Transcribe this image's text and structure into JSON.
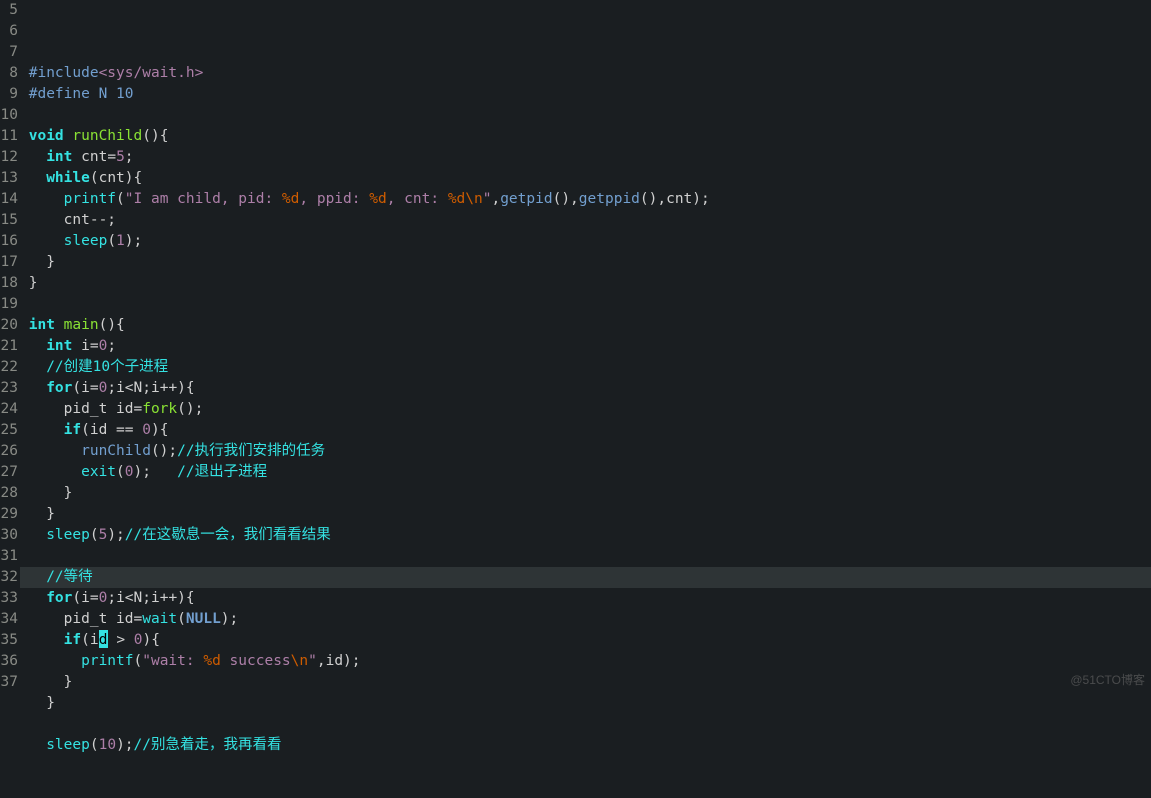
{
  "watermark": "@51CTO博客",
  "line_start": 5,
  "highlight_line": 32,
  "lines": [
    [
      {
        "c": "tk-pl",
        "t": " "
      },
      {
        "c": "tk-pp",
        "t": "#include"
      },
      {
        "c": "tk-inc",
        "t": "<sys/wait.h>"
      }
    ],
    [
      {
        "c": "tk-pl",
        "t": " "
      },
      {
        "c": "tk-pp",
        "t": "#define N 10"
      }
    ],
    [
      {
        "c": "tk-pl",
        "t": ""
      }
    ],
    [
      {
        "c": "tk-pl",
        "t": " "
      },
      {
        "c": "tk-kw",
        "t": "void"
      },
      {
        "c": "tk-pl",
        "t": " "
      },
      {
        "c": "tk-ty",
        "t": "runChild"
      },
      {
        "c": "tk-pl",
        "t": "(){"
      }
    ],
    [
      {
        "c": "tk-pl",
        "t": "   "
      },
      {
        "c": "tk-kw",
        "t": "int"
      },
      {
        "c": "tk-pl",
        "t": " cnt="
      },
      {
        "c": "tk-num",
        "t": "5"
      },
      {
        "c": "tk-pl",
        "t": ";"
      }
    ],
    [
      {
        "c": "tk-pl",
        "t": "   "
      },
      {
        "c": "tk-kw",
        "t": "while"
      },
      {
        "c": "tk-pl",
        "t": "(cnt){"
      }
    ],
    [
      {
        "c": "tk-pl",
        "t": "     "
      },
      {
        "c": "tk-fn",
        "t": "printf"
      },
      {
        "c": "tk-pl",
        "t": "("
      },
      {
        "c": "tk-str",
        "t": "\"I am child, pid: "
      },
      {
        "c": "tk-esc",
        "t": "%d"
      },
      {
        "c": "tk-str",
        "t": ", ppid: "
      },
      {
        "c": "tk-esc",
        "t": "%d"
      },
      {
        "c": "tk-str",
        "t": ", cnt: "
      },
      {
        "c": "tk-esc",
        "t": "%d\\n"
      },
      {
        "c": "tk-str",
        "t": "\""
      },
      {
        "c": "tk-pl",
        "t": ","
      },
      {
        "c": "tk-cmfn",
        "t": "getpid"
      },
      {
        "c": "tk-pl",
        "t": "(),"
      },
      {
        "c": "tk-cmfn",
        "t": "getppid"
      },
      {
        "c": "tk-pl",
        "t": "(),cnt);"
      }
    ],
    [
      {
        "c": "tk-pl",
        "t": "     cnt--;"
      }
    ],
    [
      {
        "c": "tk-pl",
        "t": "     "
      },
      {
        "c": "tk-fn",
        "t": "sleep"
      },
      {
        "c": "tk-pl",
        "t": "("
      },
      {
        "c": "tk-num",
        "t": "1"
      },
      {
        "c": "tk-pl",
        "t": ");"
      }
    ],
    [
      {
        "c": "tk-pl",
        "t": "   }"
      }
    ],
    [
      {
        "c": "tk-pl",
        "t": " }"
      }
    ],
    [
      {
        "c": "tk-pl",
        "t": ""
      }
    ],
    [
      {
        "c": "tk-pl",
        "t": " "
      },
      {
        "c": "tk-kw",
        "t": "int"
      },
      {
        "c": "tk-pl",
        "t": " "
      },
      {
        "c": "tk-ty",
        "t": "main"
      },
      {
        "c": "tk-pl",
        "t": "(){"
      }
    ],
    [
      {
        "c": "tk-pl",
        "t": "   "
      },
      {
        "c": "tk-kw",
        "t": "int"
      },
      {
        "c": "tk-pl",
        "t": " i="
      },
      {
        "c": "tk-num",
        "t": "0"
      },
      {
        "c": "tk-pl",
        "t": ";"
      }
    ],
    [
      {
        "c": "tk-pl",
        "t": "   "
      },
      {
        "c": "tk-cm",
        "t": "//创建10个子进程"
      }
    ],
    [
      {
        "c": "tk-pl",
        "t": "   "
      },
      {
        "c": "tk-kw",
        "t": "for"
      },
      {
        "c": "tk-pl",
        "t": "(i="
      },
      {
        "c": "tk-num",
        "t": "0"
      },
      {
        "c": "tk-pl",
        "t": ";i<N;i++){"
      }
    ],
    [
      {
        "c": "tk-pl",
        "t": "     pid_t id="
      },
      {
        "c": "tk-ty",
        "t": "fork"
      },
      {
        "c": "tk-pl",
        "t": "();"
      }
    ],
    [
      {
        "c": "tk-pl",
        "t": "     "
      },
      {
        "c": "tk-kw",
        "t": "if"
      },
      {
        "c": "tk-pl",
        "t": "(id == "
      },
      {
        "c": "tk-num",
        "t": "0"
      },
      {
        "c": "tk-pl",
        "t": "){"
      }
    ],
    [
      {
        "c": "tk-pl",
        "t": "       "
      },
      {
        "c": "tk-cmfn",
        "t": "runChild"
      },
      {
        "c": "tk-pl",
        "t": "();"
      },
      {
        "c": "tk-cm",
        "t": "//执行我们安排的任务"
      }
    ],
    [
      {
        "c": "tk-pl",
        "t": "       "
      },
      {
        "c": "tk-fn",
        "t": "exit"
      },
      {
        "c": "tk-pl",
        "t": "("
      },
      {
        "c": "tk-num",
        "t": "0"
      },
      {
        "c": "tk-pl",
        "t": ");   "
      },
      {
        "c": "tk-cm",
        "t": "//退出子进程"
      }
    ],
    [
      {
        "c": "tk-pl",
        "t": "     }"
      }
    ],
    [
      {
        "c": "tk-pl",
        "t": "   }"
      }
    ],
    [
      {
        "c": "tk-pl",
        "t": "   "
      },
      {
        "c": "tk-fn",
        "t": "sleep"
      },
      {
        "c": "tk-pl",
        "t": "("
      },
      {
        "c": "tk-num",
        "t": "5"
      },
      {
        "c": "tk-pl",
        "t": ");"
      },
      {
        "c": "tk-cm",
        "t": "//在这歇息一会，我们看看结果"
      }
    ],
    [
      {
        "c": "tk-pl",
        "t": ""
      }
    ],
    [
      {
        "c": "tk-pl",
        "t": "   "
      },
      {
        "c": "tk-cm",
        "t": "//等待"
      }
    ],
    [
      {
        "c": "tk-pl",
        "t": "   "
      },
      {
        "c": "tk-kw",
        "t": "for"
      },
      {
        "c": "tk-pl",
        "t": "(i="
      },
      {
        "c": "tk-num",
        "t": "0"
      },
      {
        "c": "tk-pl",
        "t": ";i<N;i++){"
      }
    ],
    [
      {
        "c": "tk-pl",
        "t": "     pid_t id="
      },
      {
        "c": "tk-fn",
        "t": "wait"
      },
      {
        "c": "tk-pl",
        "t": "("
      },
      {
        "c": "tk-const",
        "t": "NULL"
      },
      {
        "c": "tk-pl",
        "t": ");"
      }
    ],
    [
      {
        "c": "tk-pl",
        "t": "     "
      },
      {
        "c": "tk-kw",
        "t": "if"
      },
      {
        "c": "tk-pl",
        "t": "(i"
      },
      {
        "cursor": true,
        "t": "d"
      },
      {
        "c": "tk-pl",
        "t": " > "
      },
      {
        "c": "tk-num",
        "t": "0"
      },
      {
        "c": "tk-pl",
        "t": "){"
      }
    ],
    [
      {
        "c": "tk-pl",
        "t": "       "
      },
      {
        "c": "tk-fn",
        "t": "printf"
      },
      {
        "c": "tk-pl",
        "t": "("
      },
      {
        "c": "tk-str",
        "t": "\"wait: "
      },
      {
        "c": "tk-esc",
        "t": "%d"
      },
      {
        "c": "tk-str",
        "t": " success"
      },
      {
        "c": "tk-esc",
        "t": "\\n"
      },
      {
        "c": "tk-str",
        "t": "\""
      },
      {
        "c": "tk-pl",
        "t": ",id);"
      }
    ],
    [
      {
        "c": "tk-pl",
        "t": "     }"
      }
    ],
    [
      {
        "c": "tk-pl",
        "t": "   }"
      }
    ],
    [
      {
        "c": "tk-pl",
        "t": ""
      }
    ],
    [
      {
        "c": "tk-pl",
        "t": "   "
      },
      {
        "c": "tk-fn",
        "t": "sleep"
      },
      {
        "c": "tk-pl",
        "t": "("
      },
      {
        "c": "tk-num",
        "t": "10"
      },
      {
        "c": "tk-pl",
        "t": ");"
      },
      {
        "c": "tk-cm",
        "t": "//别急着走，我再看看"
      }
    ]
  ]
}
